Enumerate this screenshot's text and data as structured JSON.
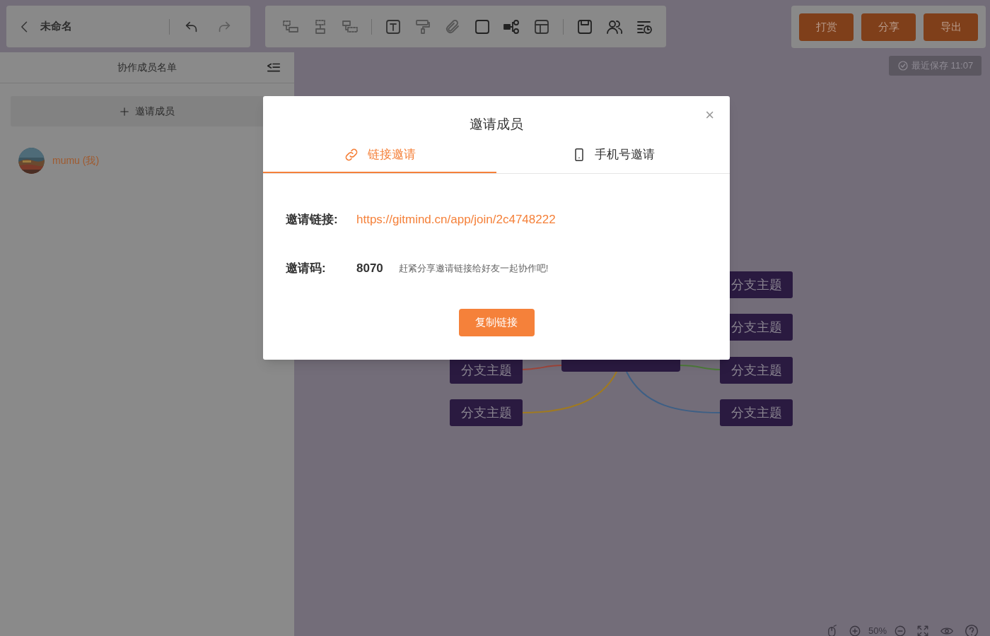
{
  "header": {
    "title": "未命名"
  },
  "actions": [
    "打赏",
    "分享",
    "导出"
  ],
  "save_status": "最近保存 11:07",
  "sidebar": {
    "title": "协作成员名单",
    "invite_button": "邀请成员",
    "members": [
      {
        "name": "mumu (我)"
      }
    ]
  },
  "mindmap": {
    "left_topics": [
      {
        "label": "分支主题",
        "color": "#a0453a"
      },
      {
        "label": "分支主题",
        "color": "#a07a20"
      }
    ],
    "right_topics": [
      {
        "label": "分支主题"
      },
      {
        "label": "分支主题"
      },
      {
        "label": "分支主题",
        "color": "#4d7a3a"
      },
      {
        "label": "分支主题",
        "color": "#3d5f85"
      }
    ]
  },
  "zoom": "50%",
  "dialog": {
    "title": "邀请成员",
    "close": "×",
    "tabs": [
      {
        "label": "链接邀请",
        "selected": true
      },
      {
        "label": "手机号邀请",
        "selected": false
      }
    ],
    "fields": [
      {
        "kind": "link",
        "label": "邀请链接:",
        "value": "https://gitmind.cn/app/join/2c4748222"
      },
      {
        "kind": "code",
        "label": "邀请码:",
        "value": "8070",
        "hint": "赶紧分享邀请链接给好友一起协作吧!"
      }
    ],
    "button": "复制链接"
  }
}
